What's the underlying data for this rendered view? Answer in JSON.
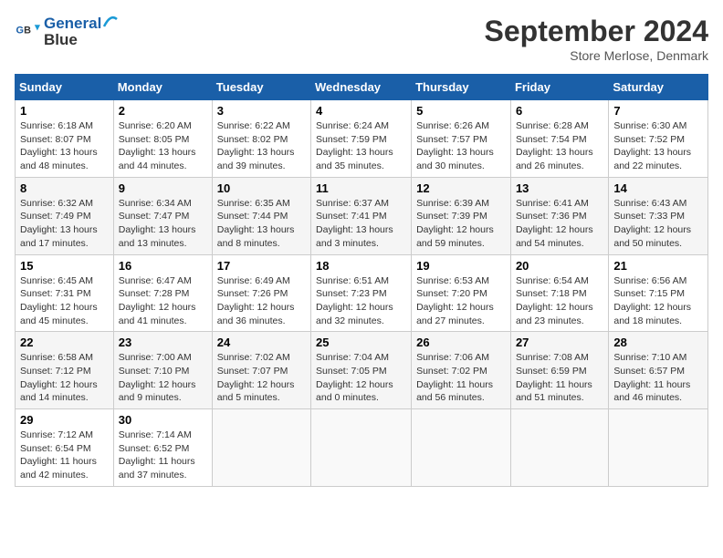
{
  "header": {
    "logo_line1": "General",
    "logo_line2": "Blue",
    "month": "September 2024",
    "location": "Store Merlose, Denmark"
  },
  "columns": [
    "Sunday",
    "Monday",
    "Tuesday",
    "Wednesday",
    "Thursday",
    "Friday",
    "Saturday"
  ],
  "weeks": [
    [
      {
        "day": "1",
        "sunrise": "6:18 AM",
        "sunset": "8:07 PM",
        "daylight": "13 hours and 48 minutes."
      },
      {
        "day": "2",
        "sunrise": "6:20 AM",
        "sunset": "8:05 PM",
        "daylight": "13 hours and 44 minutes."
      },
      {
        "day": "3",
        "sunrise": "6:22 AM",
        "sunset": "8:02 PM",
        "daylight": "13 hours and 39 minutes."
      },
      {
        "day": "4",
        "sunrise": "6:24 AM",
        "sunset": "7:59 PM",
        "daylight": "13 hours and 35 minutes."
      },
      {
        "day": "5",
        "sunrise": "6:26 AM",
        "sunset": "7:57 PM",
        "daylight": "13 hours and 30 minutes."
      },
      {
        "day": "6",
        "sunrise": "6:28 AM",
        "sunset": "7:54 PM",
        "daylight": "13 hours and 26 minutes."
      },
      {
        "day": "7",
        "sunrise": "6:30 AM",
        "sunset": "7:52 PM",
        "daylight": "13 hours and 22 minutes."
      }
    ],
    [
      {
        "day": "8",
        "sunrise": "6:32 AM",
        "sunset": "7:49 PM",
        "daylight": "13 hours and 17 minutes."
      },
      {
        "day": "9",
        "sunrise": "6:34 AM",
        "sunset": "7:47 PM",
        "daylight": "13 hours and 13 minutes."
      },
      {
        "day": "10",
        "sunrise": "6:35 AM",
        "sunset": "7:44 PM",
        "daylight": "13 hours and 8 minutes."
      },
      {
        "day": "11",
        "sunrise": "6:37 AM",
        "sunset": "7:41 PM",
        "daylight": "13 hours and 3 minutes."
      },
      {
        "day": "12",
        "sunrise": "6:39 AM",
        "sunset": "7:39 PM",
        "daylight": "12 hours and 59 minutes."
      },
      {
        "day": "13",
        "sunrise": "6:41 AM",
        "sunset": "7:36 PM",
        "daylight": "12 hours and 54 minutes."
      },
      {
        "day": "14",
        "sunrise": "6:43 AM",
        "sunset": "7:33 PM",
        "daylight": "12 hours and 50 minutes."
      }
    ],
    [
      {
        "day": "15",
        "sunrise": "6:45 AM",
        "sunset": "7:31 PM",
        "daylight": "12 hours and 45 minutes."
      },
      {
        "day": "16",
        "sunrise": "6:47 AM",
        "sunset": "7:28 PM",
        "daylight": "12 hours and 41 minutes."
      },
      {
        "day": "17",
        "sunrise": "6:49 AM",
        "sunset": "7:26 PM",
        "daylight": "12 hours and 36 minutes."
      },
      {
        "day": "18",
        "sunrise": "6:51 AM",
        "sunset": "7:23 PM",
        "daylight": "12 hours and 32 minutes."
      },
      {
        "day": "19",
        "sunrise": "6:53 AM",
        "sunset": "7:20 PM",
        "daylight": "12 hours and 27 minutes."
      },
      {
        "day": "20",
        "sunrise": "6:54 AM",
        "sunset": "7:18 PM",
        "daylight": "12 hours and 23 minutes."
      },
      {
        "day": "21",
        "sunrise": "6:56 AM",
        "sunset": "7:15 PM",
        "daylight": "12 hours and 18 minutes."
      }
    ],
    [
      {
        "day": "22",
        "sunrise": "6:58 AM",
        "sunset": "7:12 PM",
        "daylight": "12 hours and 14 minutes."
      },
      {
        "day": "23",
        "sunrise": "7:00 AM",
        "sunset": "7:10 PM",
        "daylight": "12 hours and 9 minutes."
      },
      {
        "day": "24",
        "sunrise": "7:02 AM",
        "sunset": "7:07 PM",
        "daylight": "12 hours and 5 minutes."
      },
      {
        "day": "25",
        "sunrise": "7:04 AM",
        "sunset": "7:05 PM",
        "daylight": "12 hours and 0 minutes."
      },
      {
        "day": "26",
        "sunrise": "7:06 AM",
        "sunset": "7:02 PM",
        "daylight": "11 hours and 56 minutes."
      },
      {
        "day": "27",
        "sunrise": "7:08 AM",
        "sunset": "6:59 PM",
        "daylight": "11 hours and 51 minutes."
      },
      {
        "day": "28",
        "sunrise": "7:10 AM",
        "sunset": "6:57 PM",
        "daylight": "11 hours and 46 minutes."
      }
    ],
    [
      {
        "day": "29",
        "sunrise": "7:12 AM",
        "sunset": "6:54 PM",
        "daylight": "11 hours and 42 minutes."
      },
      {
        "day": "30",
        "sunrise": "7:14 AM",
        "sunset": "6:52 PM",
        "daylight": "11 hours and 37 minutes."
      },
      null,
      null,
      null,
      null,
      null
    ]
  ],
  "labels": {
    "sunrise": "Sunrise: ",
    "sunset": "Sunset: ",
    "daylight": "Daylight: "
  }
}
